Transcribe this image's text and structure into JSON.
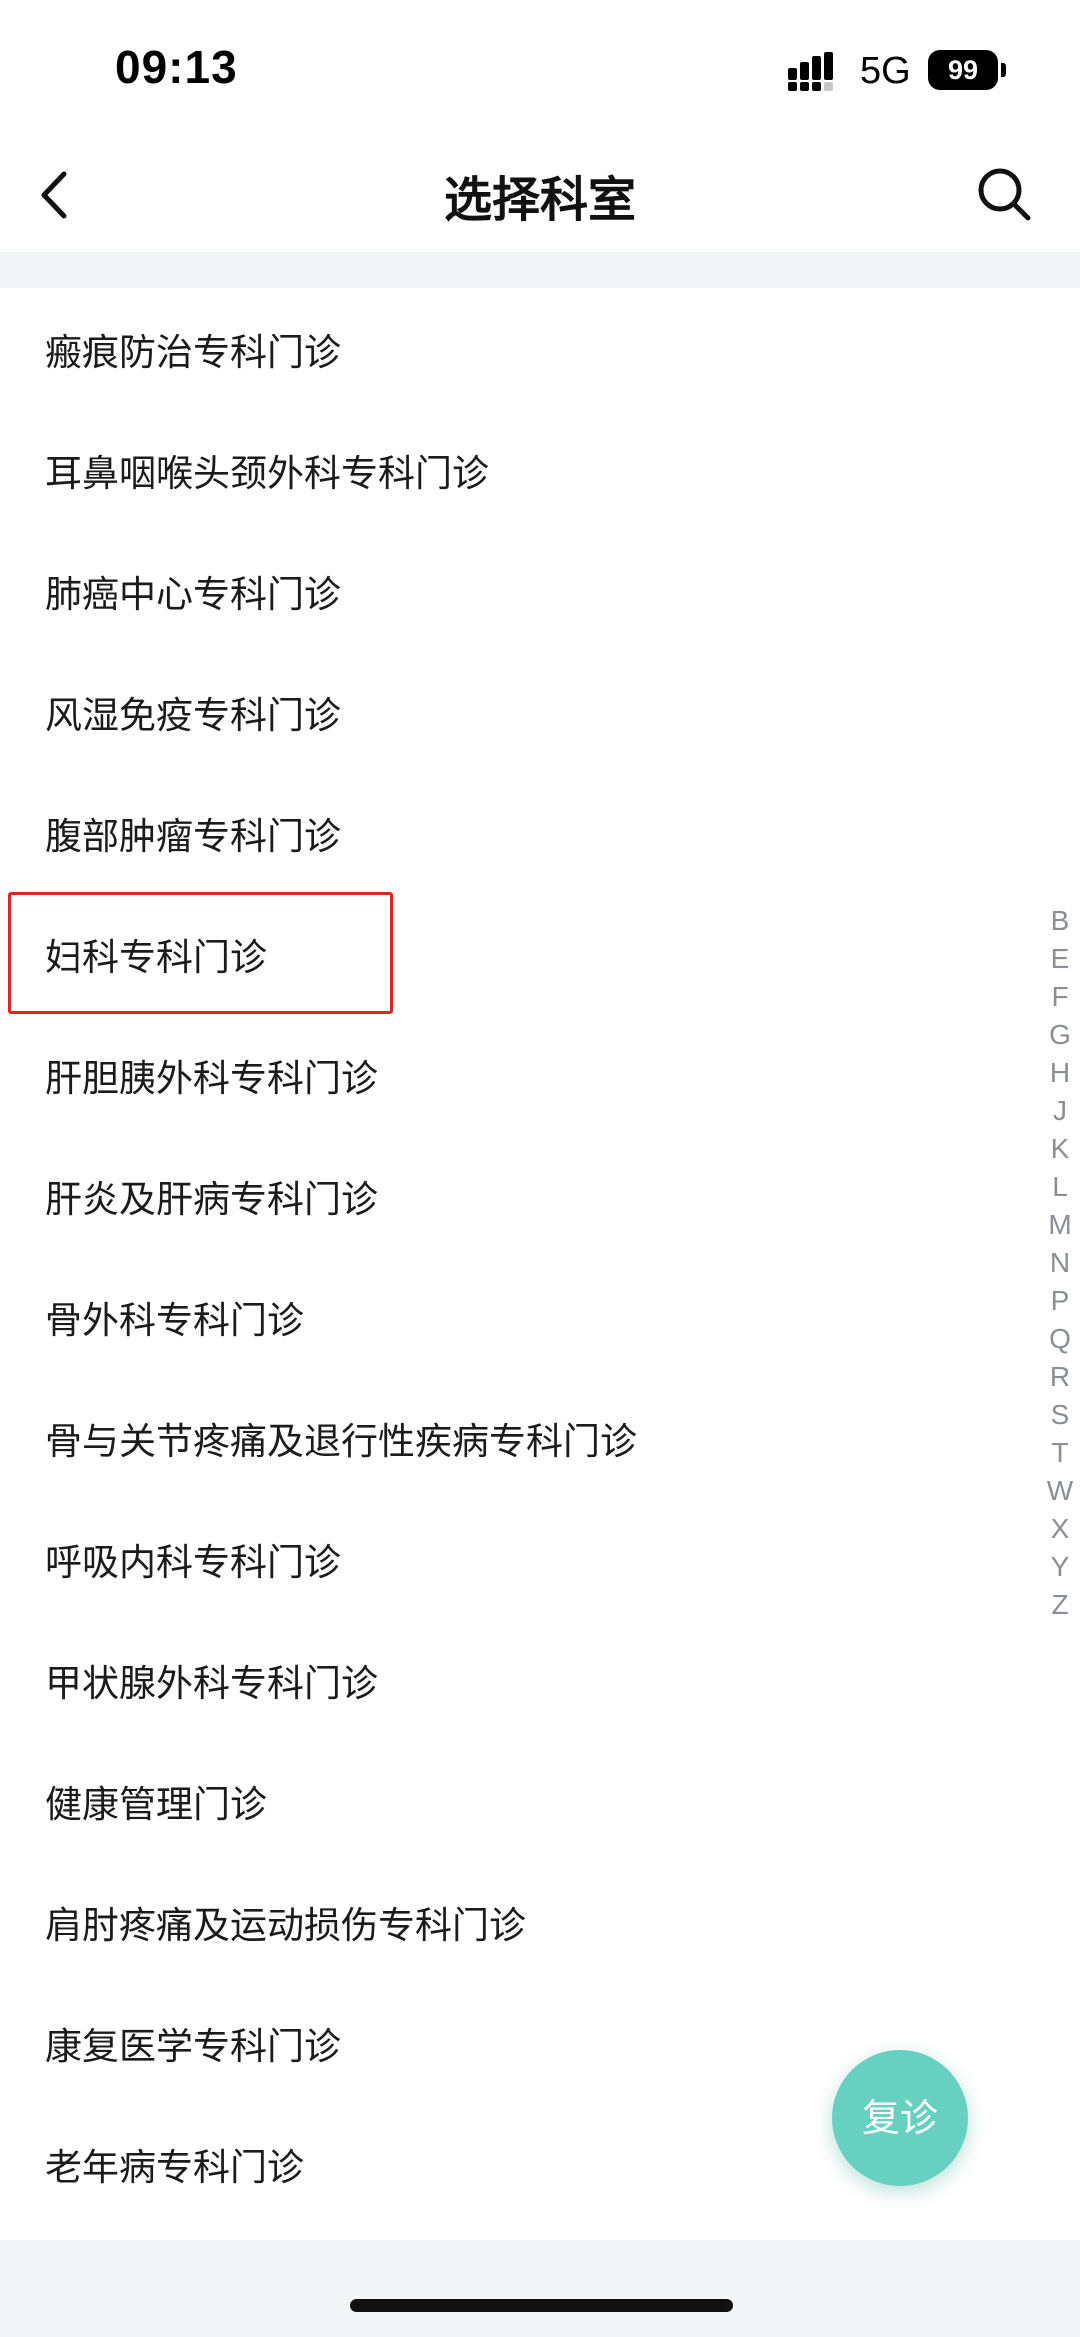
{
  "status_bar": {
    "time": "09:13",
    "network": "5G",
    "battery": "99"
  },
  "nav": {
    "title": "选择科室",
    "back_icon": "chevron-left-icon",
    "search_icon": "search-icon"
  },
  "departments": [
    {
      "name": "瘢痕防治专科门诊"
    },
    {
      "name": "耳鼻咽喉头颈外科专科门诊"
    },
    {
      "name": "肺癌中心专科门诊"
    },
    {
      "name": "风湿免疫专科门诊"
    },
    {
      "name": "腹部肿瘤专科门诊"
    },
    {
      "name": "妇科专科门诊"
    },
    {
      "name": "肝胆胰外科专科门诊"
    },
    {
      "name": "肝炎及肝病专科门诊"
    },
    {
      "name": "骨外科专科门诊"
    },
    {
      "name": "骨与关节疼痛及退行性疾病专科门诊"
    },
    {
      "name": "呼吸内科专科门诊"
    },
    {
      "name": "甲状腺外科专科门诊"
    },
    {
      "name": "健康管理门诊"
    },
    {
      "name": "肩肘疼痛及运动损伤专科门诊"
    },
    {
      "name": "康复医学专科门诊"
    },
    {
      "name": "老年病专科门诊"
    }
  ],
  "highlighted_department": "妇科专科门诊",
  "alpha_index": [
    "B",
    "E",
    "F",
    "G",
    "H",
    "J",
    "K",
    "L",
    "M",
    "N",
    "P",
    "Q",
    "R",
    "S",
    "T",
    "W",
    "X",
    "Y",
    "Z"
  ],
  "fab": {
    "label": "复诊",
    "color": "#67d0c0"
  },
  "colors": {
    "highlight_border": "#e02424",
    "index_letter": "#8a8f96",
    "separator": "#f4f5f7"
  }
}
